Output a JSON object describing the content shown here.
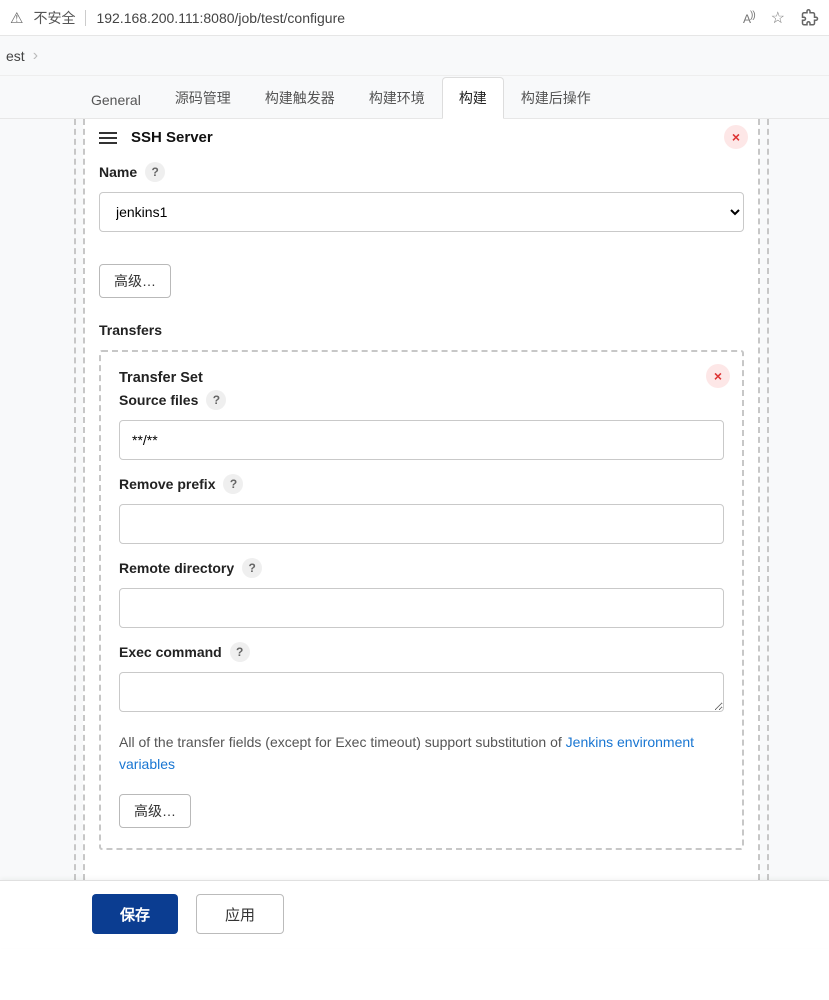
{
  "browser": {
    "insecure_label": "不安全",
    "url": "192.168.200.111:8080/job/test/configure"
  },
  "breadcrumb": {
    "item": "est"
  },
  "tabs": {
    "general": "General",
    "scm": "源码管理",
    "triggers": "构建触发器",
    "env": "构建环境",
    "build": "构建",
    "post": "构建后操作",
    "active": "build"
  },
  "ssh": {
    "section_title": "SSH Server",
    "name_label": "Name",
    "name_value": "jenkins1",
    "advanced_label": "高级…",
    "transfers_label": "Transfers"
  },
  "tset": {
    "title": "Transfer Set",
    "source_label": "Source files",
    "source_value": "**/**",
    "remove_prefix_label": "Remove prefix",
    "remove_prefix_value": "",
    "remote_dir_label": "Remote directory",
    "remote_dir_value": "",
    "exec_label": "Exec command",
    "exec_value": "",
    "hint_prefix": "All of the transfer fields (except for Exec timeout) support substitution of ",
    "hint_link": "Jenkins environment variables",
    "advanced_label": "高级…"
  },
  "footer": {
    "save": "保存",
    "apply": "应用"
  }
}
